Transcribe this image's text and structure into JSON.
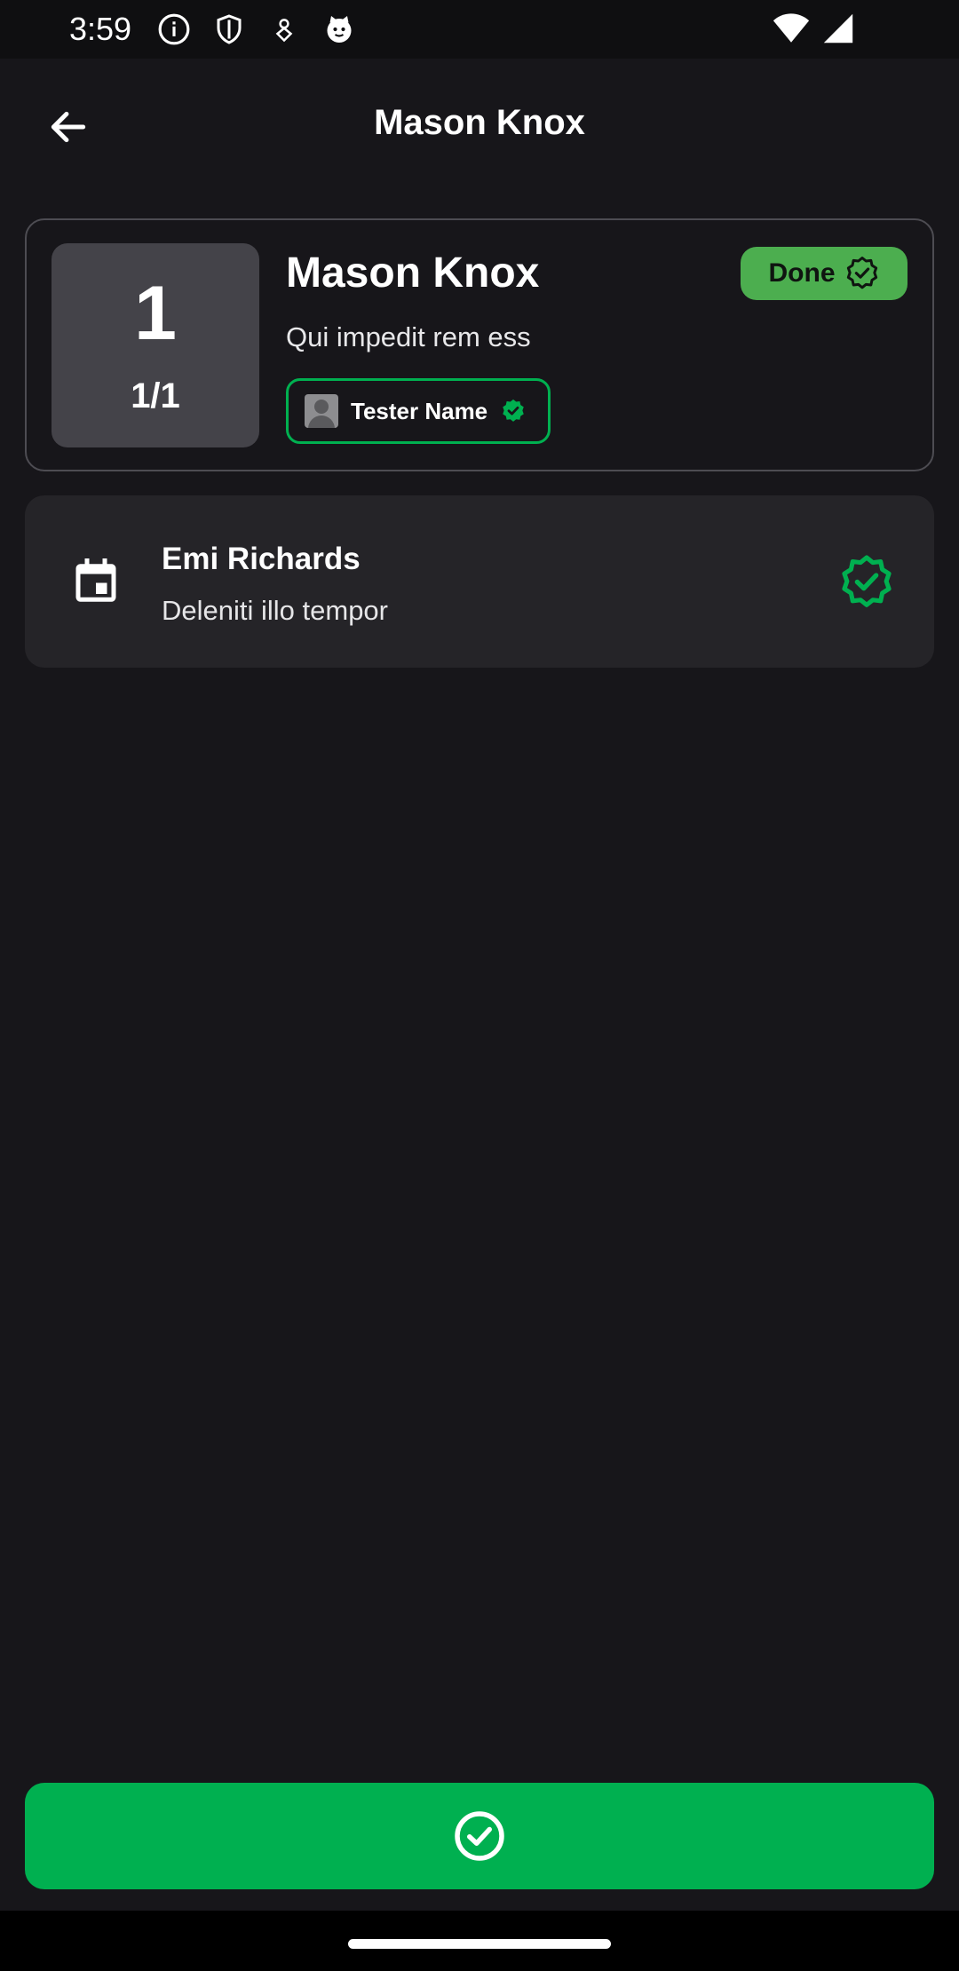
{
  "status_bar": {
    "time": "3:59",
    "left_icons": [
      "info-icon",
      "shield-icon",
      "location-pin-icon",
      "cat-face-icon"
    ],
    "right_icons": [
      "wifi-icon",
      "cell-signal-icon"
    ]
  },
  "app_bar": {
    "title": "Mason Knox",
    "back_icon": "arrow-back-icon"
  },
  "main_card": {
    "order_number": "1",
    "order_fraction": "1/1",
    "title": "Mason Knox",
    "subtitle": "Qui impedit rem ess",
    "badge_label": "Done",
    "badge_color": "#4cae4f",
    "tester": {
      "name": "Tester Name",
      "verified_color": "#00b050"
    }
  },
  "step_card": {
    "title": "Emi Richards",
    "subtitle": "Deleniti illo tempor",
    "icon": "calendar-icon",
    "status_icon": "verified-badge-icon",
    "status_color": "#00b050"
  },
  "confirm_button": {
    "icon": "check-circle-icon",
    "color": "#00b050"
  }
}
